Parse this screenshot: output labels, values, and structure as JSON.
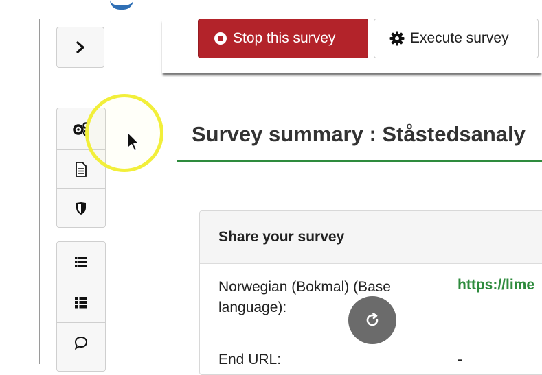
{
  "toolbar": {
    "stop_label": "Stop this survey",
    "execute_label": "Execute survey"
  },
  "page": {
    "title": "Survey summary : Ståstedsanaly"
  },
  "share_panel": {
    "heading": "Share your survey",
    "rows": [
      {
        "label": "Norwegian (Bokmal) (Base language):",
        "value": "https://lime"
      },
      {
        "label": "End URL:",
        "value": "-"
      }
    ]
  },
  "colors": {
    "accent_green": "#2e8b3d",
    "stop_red": "#b3232a",
    "highlight_yellow": "#f2ef3a"
  },
  "icons": {
    "expand": "chevron-right-icon",
    "settings": "gears-icon",
    "document": "document-icon",
    "security": "shield-icon",
    "list": "list-icon",
    "list2": "list-alt-icon",
    "comment": "comment-icon",
    "stop": "stop-circle-icon",
    "execute": "gear-icon",
    "reload": "reload-icon"
  }
}
